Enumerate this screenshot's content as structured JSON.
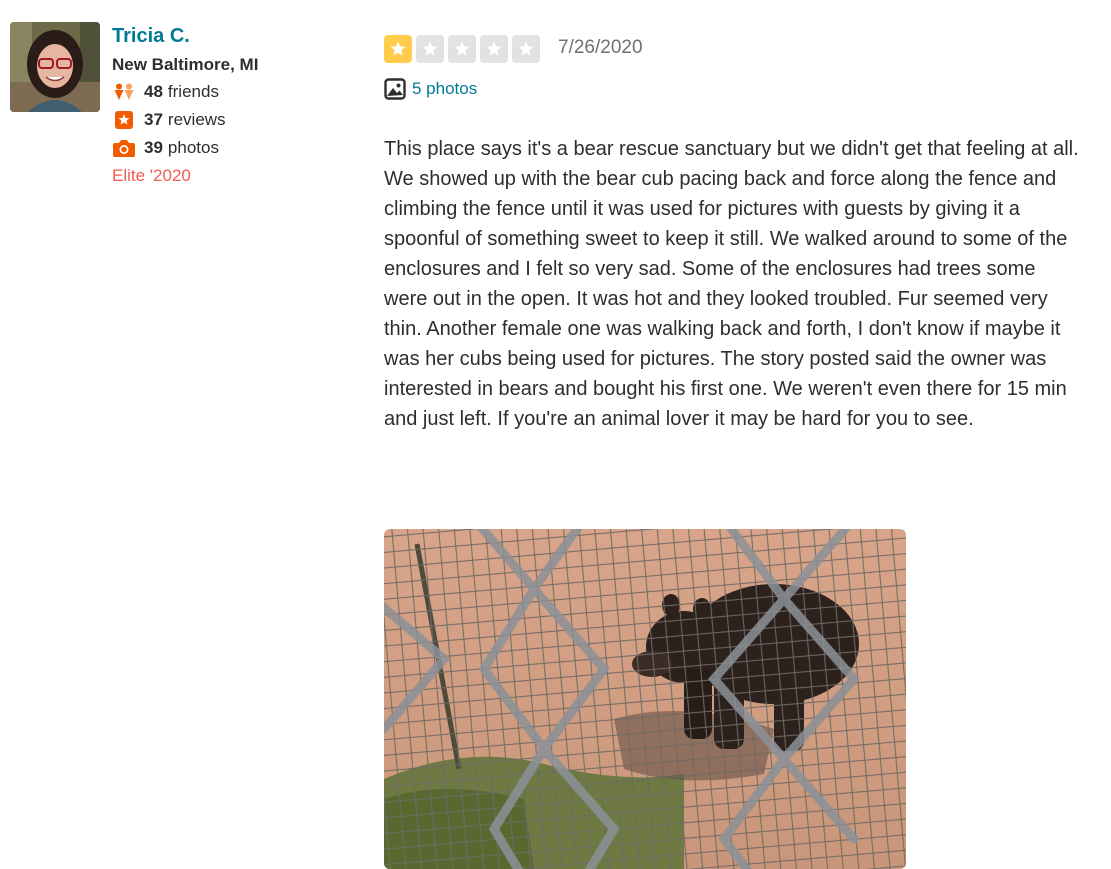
{
  "user": {
    "name": "Tricia C.",
    "location": "New Baltimore, MI",
    "friends": {
      "count": "48",
      "label": "friends"
    },
    "reviews": {
      "count": "37",
      "label": "reviews"
    },
    "photos": {
      "count": "39",
      "label": "photos"
    },
    "elite": "Elite '2020"
  },
  "review": {
    "rating": 1,
    "max_rating": 5,
    "date": "7/26/2020",
    "photos_link": "5 photos",
    "text": "This place says it's a bear rescue sanctuary but we didn't get that feeling at all. We showed up with the bear cub pacing back and force along the fence and climbing the fence until it was used for pictures with guests by giving it a spoonful of something sweet to keep it still. We walked around to some of the enclosures and I felt so very sad. Some of the enclosures had trees some were out in the open. It was hot and they looked troubled. Fur seemed very thin. Another female one was walking back and forth, I don't know if maybe it was her cubs being used for pictures. The story posted said the owner was interested in bears and bought his first one. We weren't even there for 15 min and just left. If you're an animal lover it may be hard for you to see."
  },
  "colors": {
    "name": "#027a97",
    "elite": "#f15c4f",
    "star_on": "#ffcc4b",
    "star_off": "#e1e2e3",
    "stat_icon": "#f15c00"
  }
}
